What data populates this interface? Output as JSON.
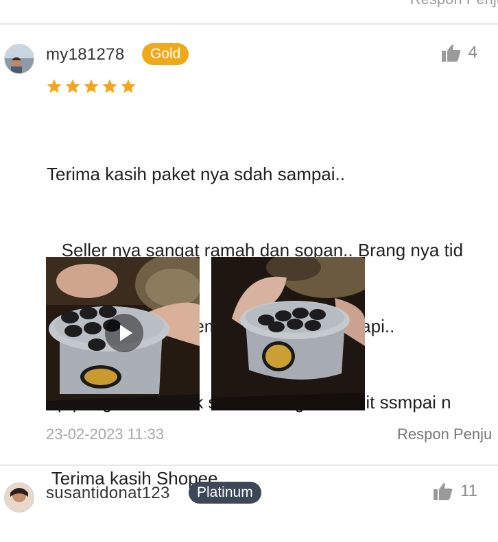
{
  "top_partial": {
    "respond_label": "Respon Penju"
  },
  "reviews": [
    {
      "username": "my181278",
      "badge": "Gold",
      "badge_color": "#f0a91b",
      "rating": 5,
      "star_color": "#f6a51b",
      "likes": "4",
      "text_lines": [
        "Terima kasih paket nya sdah sampai..",
        "   Seller nya sangat ramah dan sopan.. Brang nya tid",
        "ada cacat nya ..  Kemasan nya sangat rapi..",
        "Tp pengiriman tidak sesuai dengan istimit ssmpai n",
        " Terima kasih Shopee"
      ],
      "media": [
        {
          "kind": "video",
          "icon": "play-icon"
        },
        {
          "kind": "photo"
        }
      ],
      "timestamp": "23-02-2023 11:33",
      "respond_label": "Respon Penju"
    },
    {
      "username": "susantidonat123",
      "badge": "Platinum",
      "badge_color": "#3d4758",
      "likes": "11"
    }
  ],
  "colors": {
    "divider": "#e6e6e6",
    "like_icon": "#9a9a9a",
    "timestamp": "#a6a6a6"
  }
}
